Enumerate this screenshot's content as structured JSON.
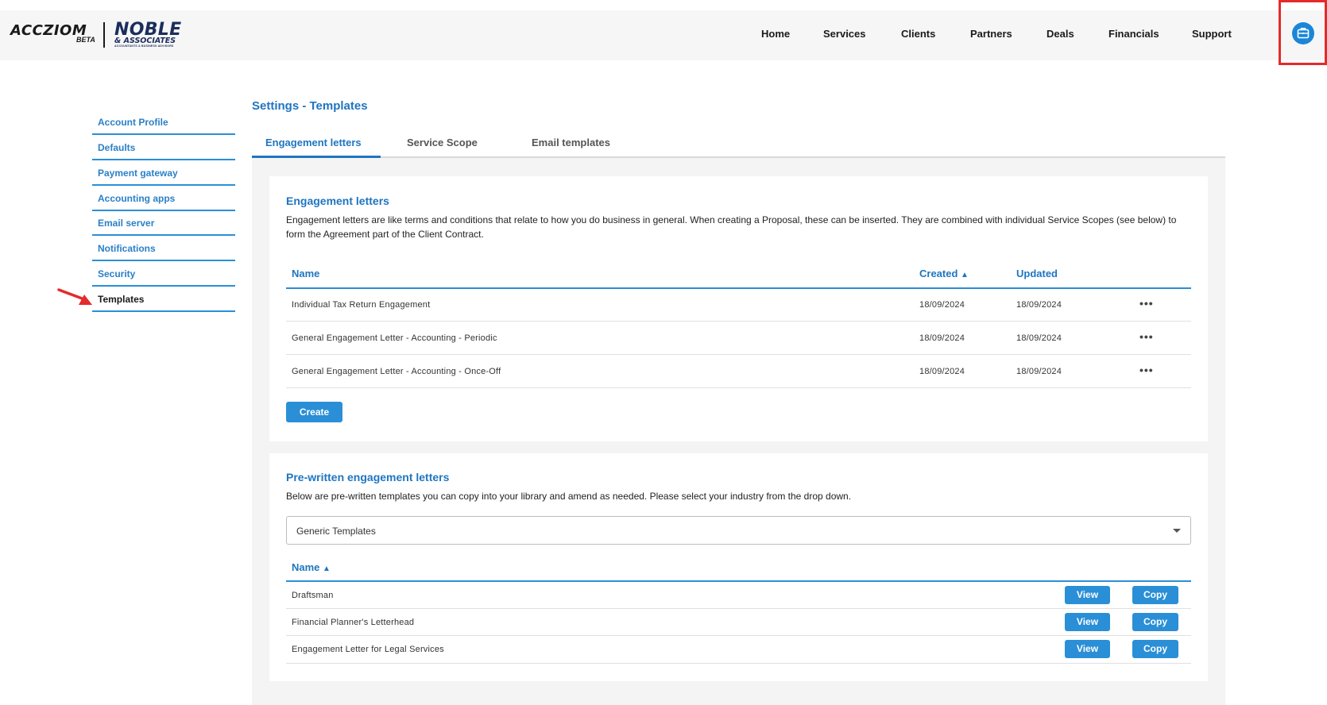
{
  "brand": {
    "app_name": "ACCZIOM",
    "app_badge": "BETA",
    "firm_name": "NOBLE",
    "firm_suffix": "& ASSOCIATES",
    "firm_tagline": "ACCOUNTANTS & BUSINESS ADVISORS"
  },
  "nav": {
    "items": [
      "Home",
      "Services",
      "Clients",
      "Partners",
      "Deals",
      "Financials",
      "Support"
    ],
    "apps_icon": "briefcase-icon"
  },
  "sidebar": {
    "items": [
      "Account Profile",
      "Defaults",
      "Payment gateway",
      "Accounting apps",
      "Email server",
      "Notifications",
      "Security",
      "Templates"
    ],
    "active": "Templates"
  },
  "page": {
    "title": "Settings - Templates",
    "tabs": [
      "Engagement letters",
      "Service Scope",
      "Email templates"
    ],
    "active_tab": "Engagement letters"
  },
  "engagement": {
    "title": "Engagement letters",
    "description": "Engagement letters are like terms and conditions that relate to how you do business in general. When creating a Proposal, these can be inserted. They are combined with individual Service Scopes (see below) to form the Agreement part of the Client Contract.",
    "columns": {
      "name": "Name",
      "created": "Created",
      "updated": "Updated"
    },
    "rows": [
      {
        "name": "Individual Tax Return Engagement",
        "created": "18/09/2024",
        "updated": "18/09/2024"
      },
      {
        "name": "General Engagement Letter - Accounting - Periodic",
        "created": "18/09/2024",
        "updated": "18/09/2024"
      },
      {
        "name": "General Engagement Letter - Accounting - Once-Off",
        "created": "18/09/2024",
        "updated": "18/09/2024"
      }
    ],
    "create_label": "Create",
    "row_menu": "•••"
  },
  "prewritten": {
    "title": "Pre-written engagement letters",
    "description": "Below are pre-written templates you can copy into your library and amend as needed. Please select your industry from the drop down.",
    "industry_selected": "Generic Templates",
    "column_name": "Name",
    "rows": [
      {
        "name": "Draftsman"
      },
      {
        "name": "Financial Planner's Letterhead"
      },
      {
        "name": "Engagement Letter for Legal Services"
      }
    ],
    "view_label": "View",
    "copy_label": "Copy"
  },
  "colors": {
    "accent": "#1f75c0",
    "button": "#2a8fd6",
    "highlight": "#e32b2b",
    "brand_navy": "#1b2d5c"
  }
}
